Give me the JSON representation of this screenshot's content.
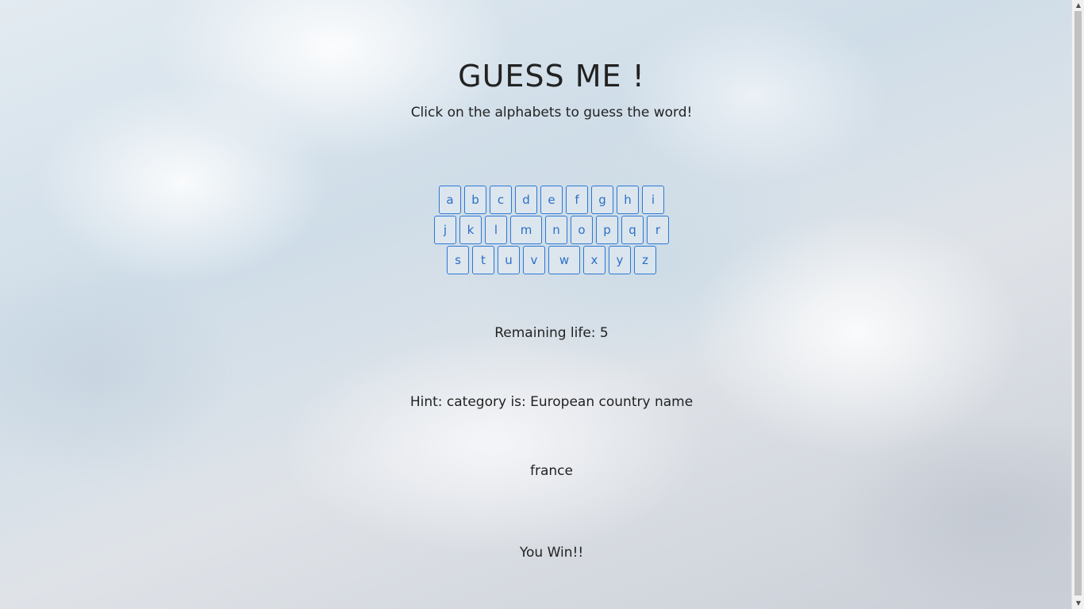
{
  "header": {
    "title": "GUESS ME !",
    "subtitle": "Click on the alphabets to guess the word!"
  },
  "keyboard": {
    "rows": [
      [
        "a",
        "b",
        "c",
        "d",
        "e",
        "f",
        "g",
        "h",
        "i"
      ],
      [
        "j",
        "k",
        "l",
        "m",
        "n",
        "o",
        "p",
        "q",
        "r"
      ],
      [
        "s",
        "t",
        "u",
        "v",
        "w",
        "x",
        "y",
        "z"
      ]
    ]
  },
  "status": {
    "life": "Remaining life: 5",
    "hint": "Hint: category is: European country name",
    "word": "france",
    "result": "You Win!!"
  },
  "colors": {
    "key_border": "#2b78d6",
    "key_text": "#2b6fc8"
  },
  "icons": {
    "scroll_up": "triangle-up-icon",
    "scroll_down": "triangle-down-icon"
  }
}
